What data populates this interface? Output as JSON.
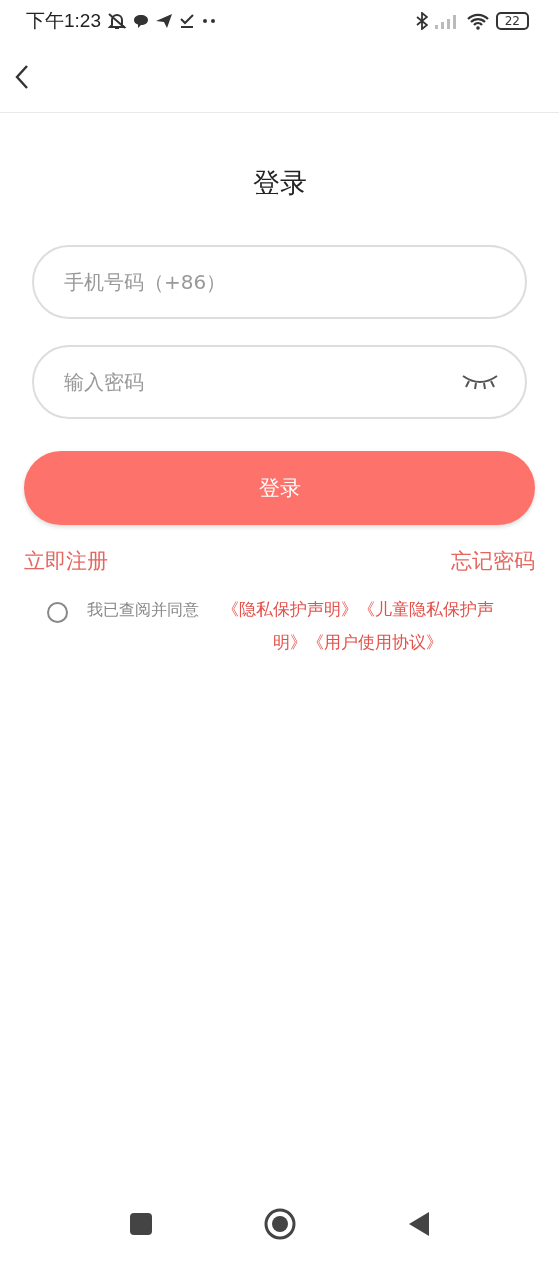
{
  "status_bar": {
    "time": "下午1:23",
    "battery": "22"
  },
  "title": "登录",
  "phone_field": {
    "placeholder": "手机号码（+86）"
  },
  "password_field": {
    "placeholder": "输入密码",
    "revealed": false
  },
  "login_button": "登录",
  "register_link": "立即注册",
  "forgot_link": "忘记密码",
  "agreement": {
    "checked": false,
    "text": "我已查阅并同意",
    "links": "《隐私保护声明》《儿童隐私保护声明》《用户使用协议》"
  }
}
